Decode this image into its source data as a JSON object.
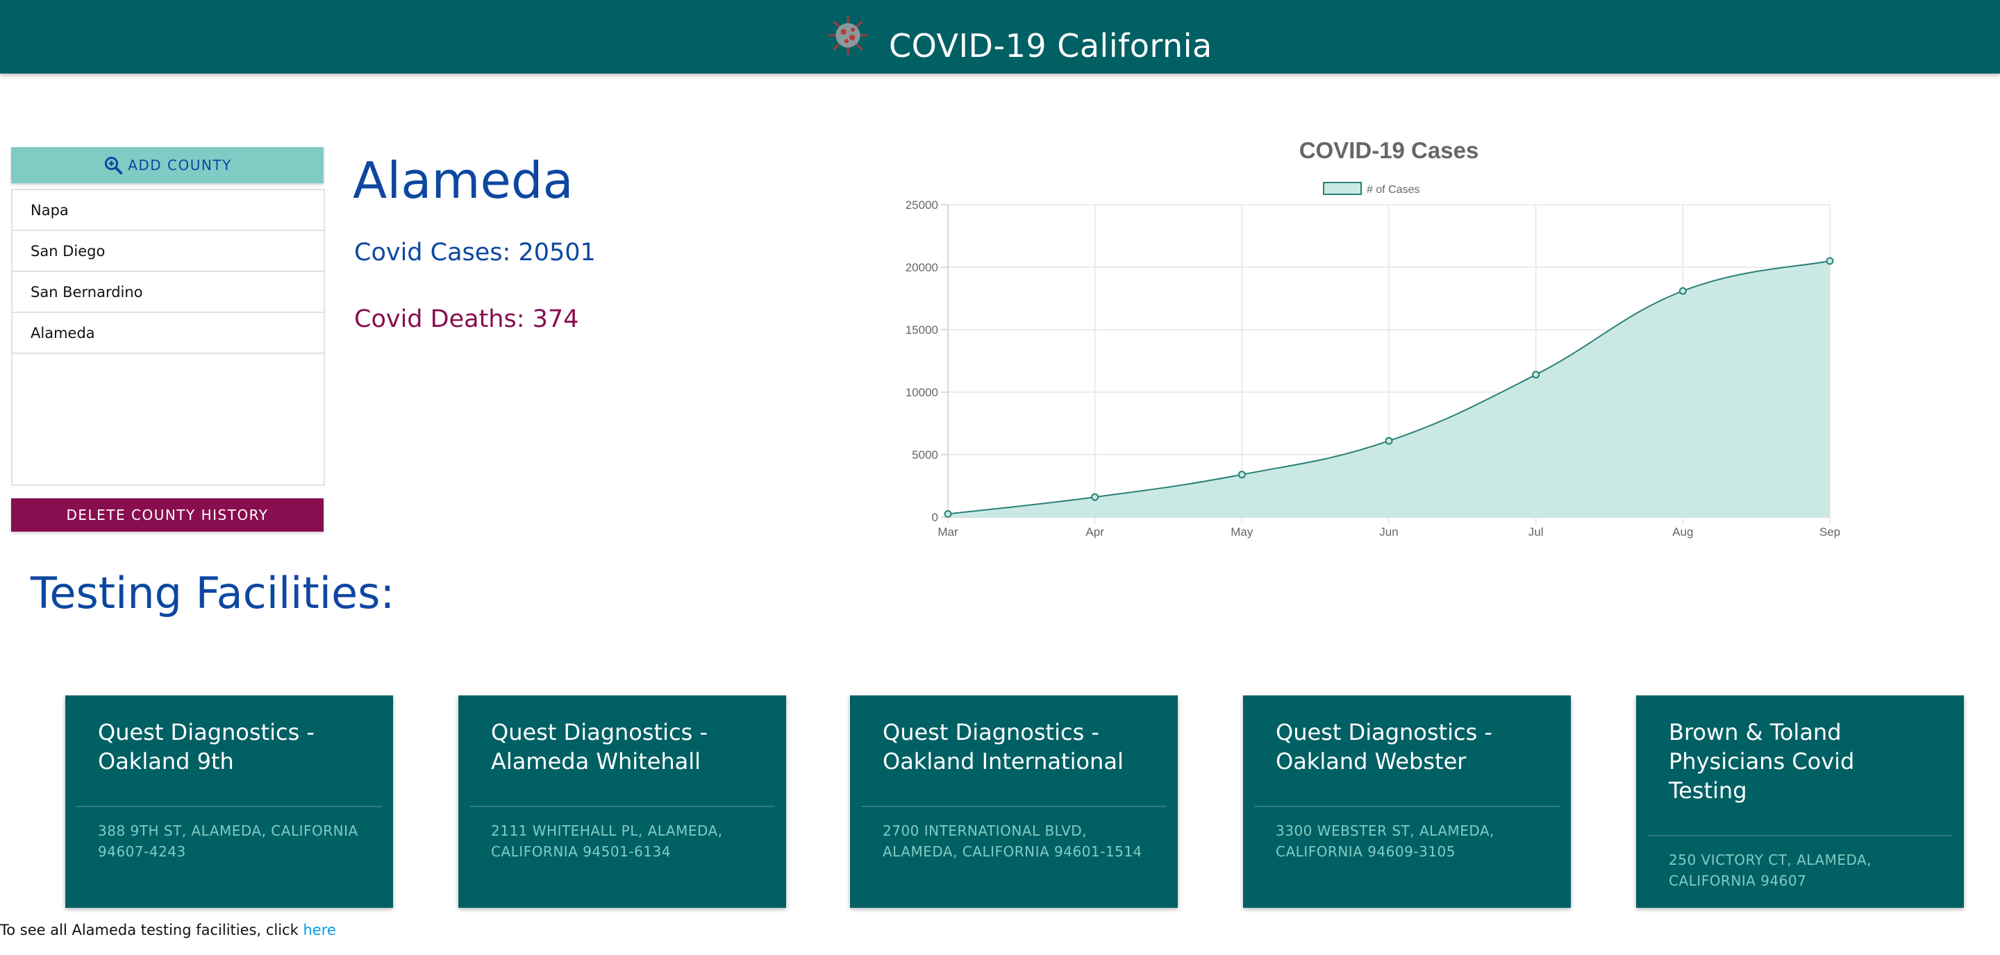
{
  "header": {
    "title": "COVID-19 California",
    "logo_icon": "virus-icon"
  },
  "sidebar": {
    "add_button_label": "ADD COUNTY",
    "add_button_icon": "zoom-in-icon",
    "counties": [
      "Napa",
      "San Diego",
      "San Bernardino",
      "Alameda"
    ],
    "delete_button_label": "DELETE COUNTY HISTORY"
  },
  "county": {
    "name": "Alameda",
    "cases_text": "Covid Cases: 20501",
    "deaths_text": "Covid Deaths: 374"
  },
  "chart_data": {
    "type": "area",
    "title": "COVID-19 Cases",
    "categories": [
      "Mar",
      "Apr",
      "May",
      "Jun",
      "Jul",
      "Aug",
      "Sep"
    ],
    "series": [
      {
        "name": "# of Cases",
        "values": [
          250,
          1600,
          3400,
          6100,
          11400,
          18100,
          20501
        ]
      }
    ],
    "ylim": [
      0,
      25000
    ],
    "yticks": [
      0,
      5000,
      10000,
      15000,
      20000,
      25000
    ],
    "grid": true,
    "legend": "top",
    "colors": {
      "fill": "#cae9e5",
      "line": "#2a8077"
    }
  },
  "testing": {
    "title": "Testing Facilities:",
    "facilities": [
      {
        "name": "Quest Diagnostics - Oakland 9th",
        "address": "388 9TH ST, ALAMEDA, CALIFORNIA 94607-4243"
      },
      {
        "name": "Quest Diagnostics - Alameda Whitehall",
        "address": "2111 WHITEHALL PL, ALAMEDA, CALIFORNIA 94501-6134"
      },
      {
        "name": "Quest Diagnostics - Oakland International",
        "address": "2700 INTERNATIONAL BLVD, ALAMEDA, CALIFORNIA 94601-1514"
      },
      {
        "name": "Quest Diagnostics - Oakland Webster",
        "address": "3300 WEBSTER ST, ALAMEDA, CALIFORNIA 94609-3105"
      },
      {
        "name": "Brown & Toland Physicians Covid Testing",
        "address": "250 VICTORY CT, ALAMEDA, CALIFORNIA 94607"
      }
    ]
  },
  "footer": {
    "text": "To see all Alameda testing facilities, click ",
    "link_label": "here"
  },
  "colors": {
    "header": "#006064",
    "accent": "#80cbc4",
    "danger": "#880e4f",
    "heading": "#0d47a1"
  }
}
